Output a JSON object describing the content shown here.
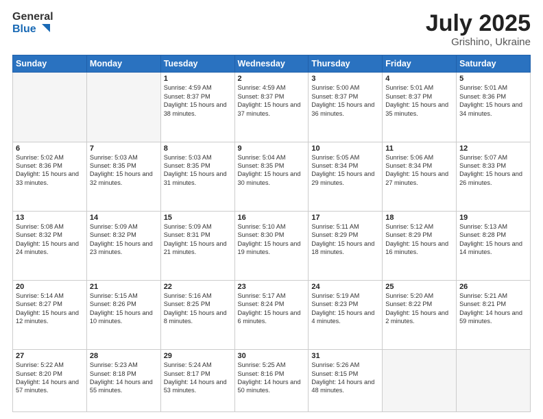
{
  "header": {
    "logo_line1": "General",
    "logo_line2": "Blue",
    "month": "July 2025",
    "location": "Grishino, Ukraine"
  },
  "weekdays": [
    "Sunday",
    "Monday",
    "Tuesday",
    "Wednesday",
    "Thursday",
    "Friday",
    "Saturday"
  ],
  "weeks": [
    [
      {
        "day": "",
        "info": ""
      },
      {
        "day": "",
        "info": ""
      },
      {
        "day": "1",
        "info": "Sunrise: 4:59 AM\nSunset: 8:37 PM\nDaylight: 15 hours and 38 minutes."
      },
      {
        "day": "2",
        "info": "Sunrise: 4:59 AM\nSunset: 8:37 PM\nDaylight: 15 hours and 37 minutes."
      },
      {
        "day": "3",
        "info": "Sunrise: 5:00 AM\nSunset: 8:37 PM\nDaylight: 15 hours and 36 minutes."
      },
      {
        "day": "4",
        "info": "Sunrise: 5:01 AM\nSunset: 8:37 PM\nDaylight: 15 hours and 35 minutes."
      },
      {
        "day": "5",
        "info": "Sunrise: 5:01 AM\nSunset: 8:36 PM\nDaylight: 15 hours and 34 minutes."
      }
    ],
    [
      {
        "day": "6",
        "info": "Sunrise: 5:02 AM\nSunset: 8:36 PM\nDaylight: 15 hours and 33 minutes."
      },
      {
        "day": "7",
        "info": "Sunrise: 5:03 AM\nSunset: 8:35 PM\nDaylight: 15 hours and 32 minutes."
      },
      {
        "day": "8",
        "info": "Sunrise: 5:03 AM\nSunset: 8:35 PM\nDaylight: 15 hours and 31 minutes."
      },
      {
        "day": "9",
        "info": "Sunrise: 5:04 AM\nSunset: 8:35 PM\nDaylight: 15 hours and 30 minutes."
      },
      {
        "day": "10",
        "info": "Sunrise: 5:05 AM\nSunset: 8:34 PM\nDaylight: 15 hours and 29 minutes."
      },
      {
        "day": "11",
        "info": "Sunrise: 5:06 AM\nSunset: 8:34 PM\nDaylight: 15 hours and 27 minutes."
      },
      {
        "day": "12",
        "info": "Sunrise: 5:07 AM\nSunset: 8:33 PM\nDaylight: 15 hours and 26 minutes."
      }
    ],
    [
      {
        "day": "13",
        "info": "Sunrise: 5:08 AM\nSunset: 8:32 PM\nDaylight: 15 hours and 24 minutes."
      },
      {
        "day": "14",
        "info": "Sunrise: 5:09 AM\nSunset: 8:32 PM\nDaylight: 15 hours and 23 minutes."
      },
      {
        "day": "15",
        "info": "Sunrise: 5:09 AM\nSunset: 8:31 PM\nDaylight: 15 hours and 21 minutes."
      },
      {
        "day": "16",
        "info": "Sunrise: 5:10 AM\nSunset: 8:30 PM\nDaylight: 15 hours and 19 minutes."
      },
      {
        "day": "17",
        "info": "Sunrise: 5:11 AM\nSunset: 8:29 PM\nDaylight: 15 hours and 18 minutes."
      },
      {
        "day": "18",
        "info": "Sunrise: 5:12 AM\nSunset: 8:29 PM\nDaylight: 15 hours and 16 minutes."
      },
      {
        "day": "19",
        "info": "Sunrise: 5:13 AM\nSunset: 8:28 PM\nDaylight: 15 hours and 14 minutes."
      }
    ],
    [
      {
        "day": "20",
        "info": "Sunrise: 5:14 AM\nSunset: 8:27 PM\nDaylight: 15 hours and 12 minutes."
      },
      {
        "day": "21",
        "info": "Sunrise: 5:15 AM\nSunset: 8:26 PM\nDaylight: 15 hours and 10 minutes."
      },
      {
        "day": "22",
        "info": "Sunrise: 5:16 AM\nSunset: 8:25 PM\nDaylight: 15 hours and 8 minutes."
      },
      {
        "day": "23",
        "info": "Sunrise: 5:17 AM\nSunset: 8:24 PM\nDaylight: 15 hours and 6 minutes."
      },
      {
        "day": "24",
        "info": "Sunrise: 5:19 AM\nSunset: 8:23 PM\nDaylight: 15 hours and 4 minutes."
      },
      {
        "day": "25",
        "info": "Sunrise: 5:20 AM\nSunset: 8:22 PM\nDaylight: 15 hours and 2 minutes."
      },
      {
        "day": "26",
        "info": "Sunrise: 5:21 AM\nSunset: 8:21 PM\nDaylight: 14 hours and 59 minutes."
      }
    ],
    [
      {
        "day": "27",
        "info": "Sunrise: 5:22 AM\nSunset: 8:20 PM\nDaylight: 14 hours and 57 minutes."
      },
      {
        "day": "28",
        "info": "Sunrise: 5:23 AM\nSunset: 8:18 PM\nDaylight: 14 hours and 55 minutes."
      },
      {
        "day": "29",
        "info": "Sunrise: 5:24 AM\nSunset: 8:17 PM\nDaylight: 14 hours and 53 minutes."
      },
      {
        "day": "30",
        "info": "Sunrise: 5:25 AM\nSunset: 8:16 PM\nDaylight: 14 hours and 50 minutes."
      },
      {
        "day": "31",
        "info": "Sunrise: 5:26 AM\nSunset: 8:15 PM\nDaylight: 14 hours and 48 minutes."
      },
      {
        "day": "",
        "info": ""
      },
      {
        "day": "",
        "info": ""
      }
    ]
  ]
}
